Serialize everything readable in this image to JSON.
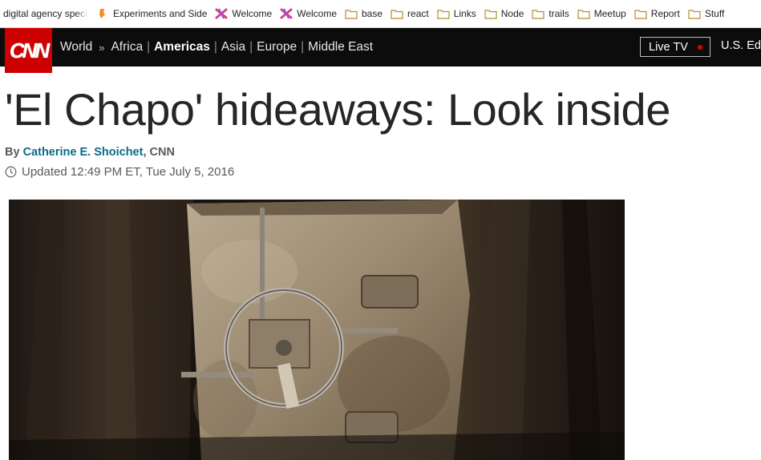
{
  "bookmarks": [
    {
      "label": "digital agency speci",
      "icon": "page-icon"
    },
    {
      "label": "Experiments and Side",
      "icon": "orange-tag-icon"
    },
    {
      "label": "Welcome",
      "icon": "pink-x-icon"
    },
    {
      "label": "Welcome",
      "icon": "pink-x-icon"
    },
    {
      "label": "base",
      "icon": "folder-icon"
    },
    {
      "label": "react",
      "icon": "folder-icon"
    },
    {
      "label": "Links",
      "icon": "folder-icon"
    },
    {
      "label": "Node",
      "icon": "folder-icon"
    },
    {
      "label": "trails",
      "icon": "folder-icon"
    },
    {
      "label": "Meetup",
      "icon": "folder-icon"
    },
    {
      "label": "Report",
      "icon": "folder-icon"
    },
    {
      "label": "Stuff",
      "icon": "folder-icon"
    }
  ],
  "nav": {
    "logo": "CNN",
    "section": "World",
    "arrow": "»",
    "links": [
      "Africa",
      "Americas",
      "Asia",
      "Europe",
      "Middle East"
    ],
    "active": "Americas",
    "live_tv": "Live TV",
    "edition": "U.S. Ed"
  },
  "article": {
    "headline": "'El Chapo' hideaways: Look inside",
    "by": "By",
    "author": "Catherine E. Shoichet",
    "source": ", CNN",
    "updated": "Updated 12:49 PM ET, Tue July 5, 2016"
  },
  "colors": {
    "cnn_red": "#cc0000",
    "nav_bg": "#0c0c0c",
    "author_link": "#0c6a89",
    "live_dot": "#e50000"
  }
}
